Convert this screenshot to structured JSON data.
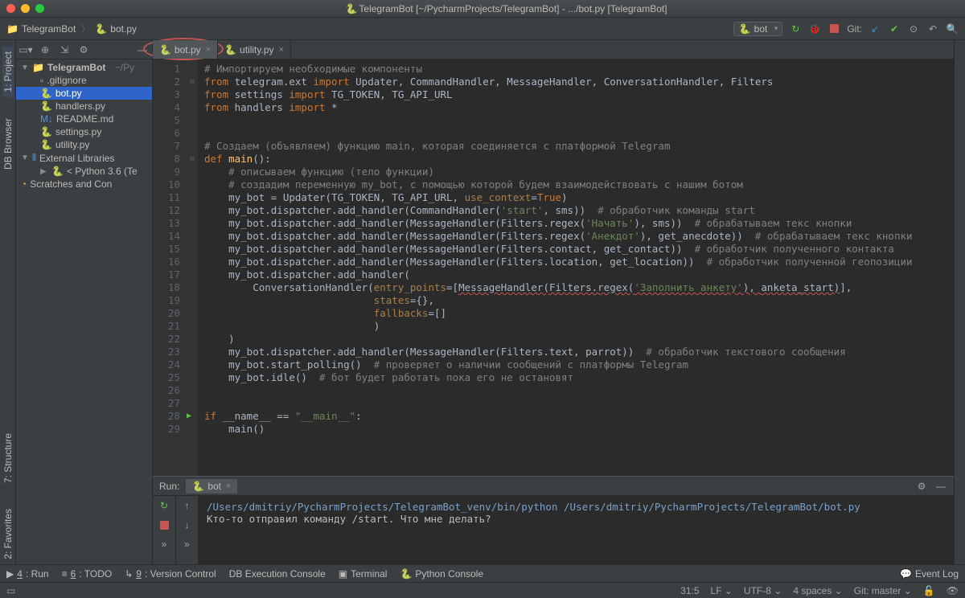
{
  "titlebar": {
    "title": "TelegramBot [~/PycharmProjects/TelegramBot] - .../bot.py [TelegramBot]"
  },
  "toolbar": {
    "breadcrumb": {
      "project": "TelegramBot",
      "file": "bot.py"
    },
    "run_config": "bot",
    "git_label": "Git:"
  },
  "side_tabs": {
    "project": "1: Project",
    "db": "DB Browser",
    "structure": "7: Structure",
    "favorites": "2: Favorites"
  },
  "tree": {
    "root": "TelegramBot",
    "root_path": "~/Py",
    "items": [
      ".gitignore",
      "bot.py",
      "handlers.py",
      "README.md",
      "settings.py",
      "utility.py"
    ],
    "external": "External Libraries",
    "python": "< Python 3.6 (Te",
    "scratches": "Scratches and Con"
  },
  "tabs": {
    "bot": "bot.py",
    "utility": "utility.py"
  },
  "code": {
    "l1": "# Импортируем необходимые компоненты",
    "l2a": "from",
    "l2b": " telegram.ext ",
    "l2c": "import",
    "l2d": " Updater, CommandHandler, MessageHandler, ConversationHandler, Filters",
    "l3a": "from",
    "l3b": " settings ",
    "l3c": "import",
    "l3d": " TG_TOKEN, TG_API_URL",
    "l4a": "from",
    "l4b": " handlers ",
    "l4c": "import",
    "l4d": " *",
    "l7": "# Создаем (объявляем) функцию main, которая соединяется с платформой Telegram",
    "l8a": "def ",
    "l8b": "main",
    "l8c": "():",
    "l9": "    # описываем функцию (тело функции)",
    "l10": "    # создадим переменную my_bot, с помощью которой будем взаимодействовать с нашим ботом",
    "l11a": "    my_bot = Updater(TG_TOKEN, TG_API_URL, ",
    "l11b": "use_context",
    "l11c": "=",
    "l11d": "True",
    "l11e": ")",
    "l12a": "    my_bot.dispatcher.add_handler(CommandHandler(",
    "l12b": "'start'",
    "l12c": ", sms))  ",
    "l12d": "# обработчик команды start",
    "l13a": "    my_bot.dispatcher.add_handler(MessageHandler(Filters.regex(",
    "l13b": "'Начать'",
    "l13c": "), sms))  ",
    "l13d": "# обрабатываем текс кнопки",
    "l14a": "    my_bot.dispatcher.add_handler(MessageHandler(Filters.regex(",
    "l14b": "'Анекдот'",
    "l14c": "), get_anecdote))  ",
    "l14d": "# обрабатываем текс кнопки",
    "l15a": "    my_bot.dispatcher.add_handler(MessageHandler(Filters.contact, get_contact))  ",
    "l15b": "# обработчик полученного контакта",
    "l16a": "    my_bot.dispatcher.add_handler(MessageHandler(Filters.location, get_location))  ",
    "l16b": "# обработчик полученной геопозиции",
    "l17": "    my_bot.dispatcher.add_handler(",
    "l18a": "        ConversationHandler(",
    "l18b": "entry_points",
    "l18c": "=[",
    "l18d": "MessageHandler(Filters.regex(",
    "l18e": "'Заполнить анкету'",
    "l18f": "), ",
    "l18g": "anketa_start)",
    "l18h": "],",
    "l19a": "                            ",
    "l19b": "states",
    "l19c": "={},",
    "l20a": "                            ",
    "l20b": "fallbacks",
    "l20c": "=[]",
    "l21": "                            )",
    "l22": "    )",
    "l23a": "    my_bot.dispatcher.add_handler(MessageHandler(Filters.text, parrot))  ",
    "l23b": "# обработчик текстового сообщения",
    "l24a": "    my_bot.start_polling()  ",
    "l24b": "# проверяет о наличии сообщений с платформы Telegram",
    "l25a": "    my_bot.idle()  ",
    "l25b": "# бот будет работать пока его не остановят",
    "l28a": "if ",
    "l28b": "__name__ == ",
    "l28c": "\"__main__\"",
    "l28d": ":",
    "l29": "    main()"
  },
  "run": {
    "label": "Run:",
    "tab": "bot",
    "line1": "/Users/dmitriy/PycharmProjects/TelegramBot_venv/bin/python /Users/dmitriy/PycharmProjects/TelegramBot/bot.py",
    "line2": "Кто-то отправил команду /start. Что мне делать?"
  },
  "bottom": {
    "run": "4: Run",
    "todo": "6: TODO",
    "vcs": "9: Version Control",
    "db": "DB Execution Console",
    "terminal": "Terminal",
    "pyconsole": "Python Console",
    "eventlog": "Event Log"
  },
  "status": {
    "pos": "31:5",
    "lf": "LF",
    "enc": "UTF-8",
    "indent": "4 spaces",
    "git": "Git: master"
  }
}
